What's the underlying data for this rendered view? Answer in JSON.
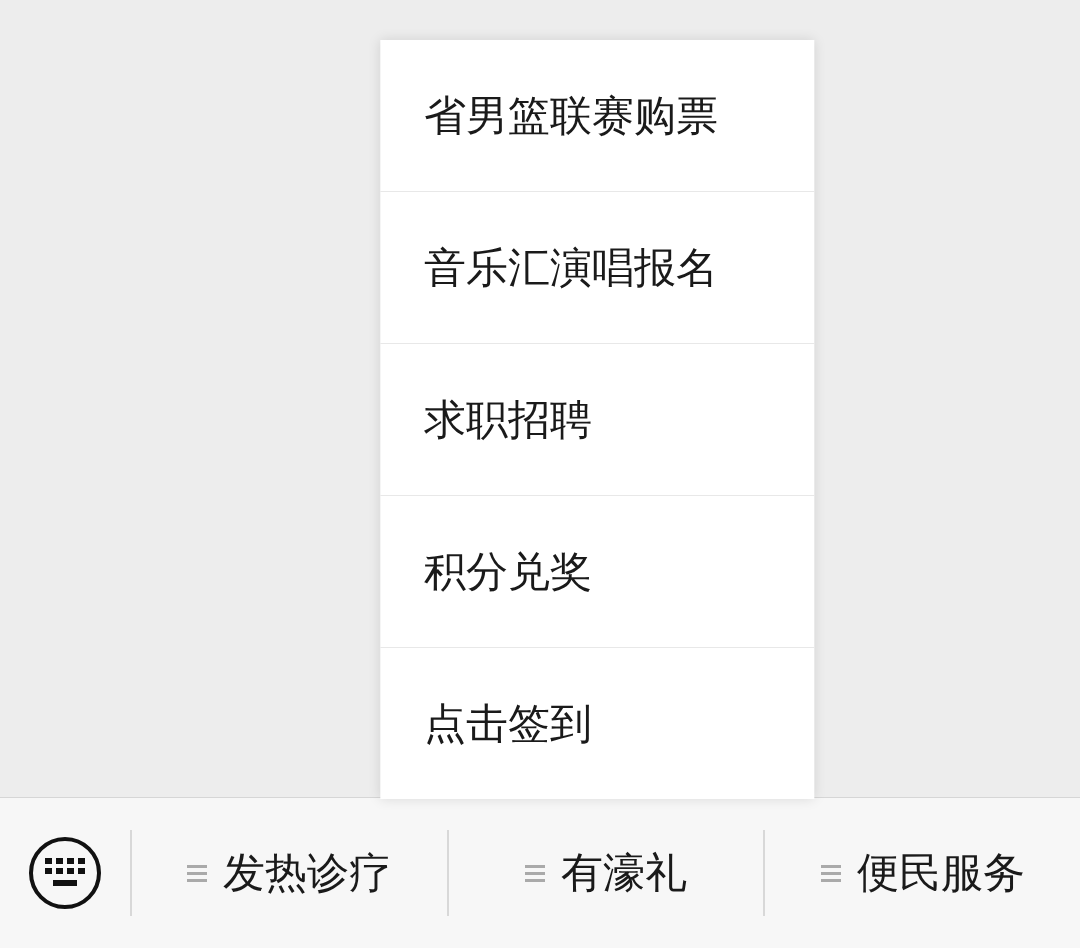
{
  "menu_bar": {
    "items": [
      {
        "label": "发热诊疗"
      },
      {
        "label": "有濠礼",
        "submenu": [
          "省男篮联赛购票",
          "音乐汇演唱报名",
          "求职招聘",
          "积分兑奖",
          "点击签到"
        ]
      },
      {
        "label": "便民服务"
      }
    ]
  }
}
